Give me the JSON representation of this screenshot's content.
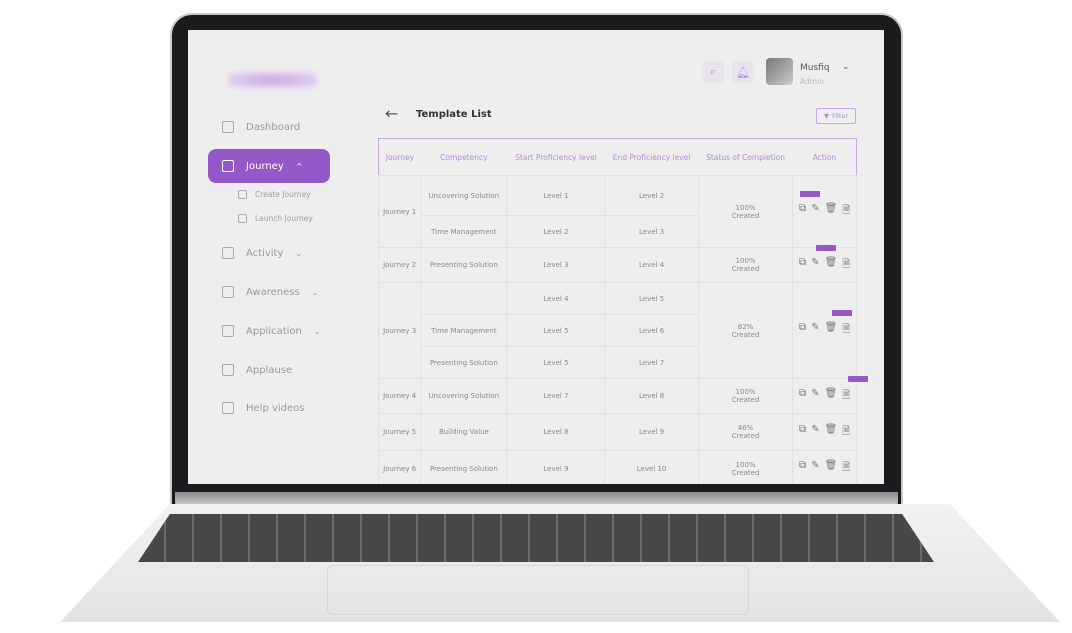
{
  "header": {
    "user_name": "Musfiq",
    "user_role": "Admin",
    "search_icon": "search-icon",
    "bell_icon": "bell-icon"
  },
  "sidebar": {
    "items": [
      {
        "label": "Dashboard",
        "icon": "pie-chart-icon"
      },
      {
        "label": "Journey",
        "icon": "journey-icon",
        "active": true,
        "expanded": true,
        "children": [
          {
            "label": "Create Journey",
            "icon": "edit-icon"
          },
          {
            "label": "Launch Journey",
            "icon": "swap-icon"
          }
        ]
      },
      {
        "label": "Activity",
        "icon": "layout-icon",
        "has_dropdown": true
      },
      {
        "label": "Awareness",
        "icon": "ribbon-icon",
        "has_dropdown": true
      },
      {
        "label": "Application",
        "icon": "document-icon",
        "has_dropdown": true
      },
      {
        "label": "Applause",
        "icon": "clap-icon"
      },
      {
        "label": "Help videos",
        "icon": "video-user-icon"
      }
    ]
  },
  "page": {
    "title": "Template List",
    "filter_label": "Filter"
  },
  "table": {
    "columns": [
      "Journey",
      "Competency",
      "Start Proficiency level",
      "End Proficiency level",
      "Status of Completion",
      "Action"
    ],
    "rows": [
      {
        "journey": "Journey 1",
        "status": "100%",
        "status_sub": "Created",
        "items": [
          [
            "Uncovering Solution",
            "Level 1",
            "Level 2"
          ],
          [
            "Time Management",
            "Level 2",
            "Level 3"
          ]
        ]
      },
      {
        "journey": "Journey 2",
        "status": "100%",
        "status_sub": "Created",
        "items": [
          [
            "Presenting Solution",
            "Level 3",
            "Level 4"
          ]
        ]
      },
      {
        "journey": "Journey 3",
        "status": "82%",
        "status_sub": "Created",
        "items": [
          [
            "",
            "Level 4",
            "Level 5"
          ],
          [
            "Time Management",
            "Level 5",
            "Level 6"
          ],
          [
            "Presenting Solution",
            "Level 5",
            "Level 7"
          ]
        ]
      },
      {
        "journey": "Journey 4",
        "status": "100%",
        "status_sub": "Created",
        "items": [
          [
            "Uncovering Solution",
            "Level 7",
            "Level 8"
          ]
        ]
      },
      {
        "journey": "Journey 5",
        "status": "46%",
        "status_sub": "Created",
        "items": [
          [
            "Building Value",
            "Level 8",
            "Level 9"
          ]
        ]
      },
      {
        "journey": "Journey 6",
        "status": "100%",
        "status_sub": "Created",
        "items": [
          [
            "Presenting Solution",
            "Level 9",
            "Level 10"
          ]
        ]
      }
    ],
    "actions": [
      "copy-icon",
      "edit-icon",
      "delete-icon",
      "export-icon"
    ]
  },
  "colors": {
    "accent": "#9458c8",
    "header_text": "#b38ad8"
  }
}
